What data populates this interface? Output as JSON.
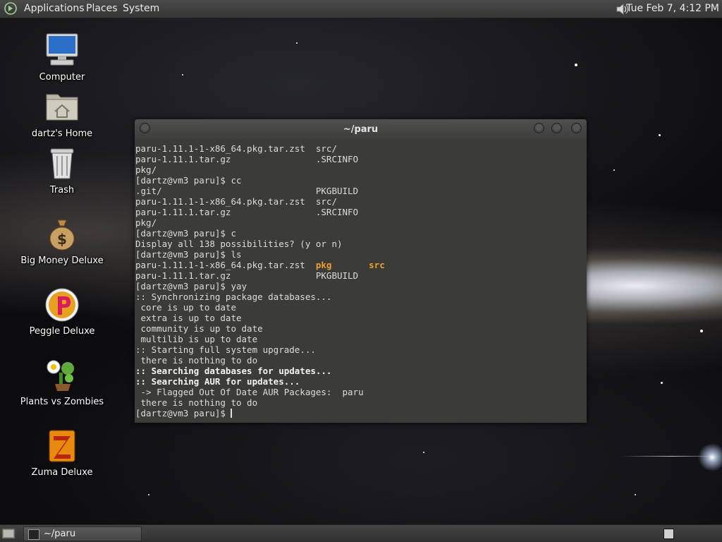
{
  "top_panel": {
    "menus": [
      "Applications",
      "Places",
      "System"
    ],
    "clock": "Tue Feb  7,  4:12 PM",
    "volume_icon": "speaker-icon"
  },
  "desktop": {
    "icons": [
      {
        "label": "Computer",
        "icon": "computer-icon"
      },
      {
        "label": "dartz's Home",
        "icon": "home-folder-icon"
      },
      {
        "label": "Trash",
        "icon": "trash-icon"
      },
      {
        "label": "Big Money Deluxe",
        "icon": "money-bag-icon"
      },
      {
        "label": "Peggle Deluxe",
        "icon": "peggle-icon"
      },
      {
        "label": "Plants vs Zombies",
        "icon": "plant-icon"
      },
      {
        "label": "Zuma Deluxe",
        "icon": "zuma-icon"
      }
    ]
  },
  "terminal": {
    "title": "~/paru",
    "lines": [
      [
        {
          "t": "paru-1.11.1-1-x86_64.pkg.tar.zst  src/"
        }
      ],
      [
        {
          "t": "paru-1.11.1.tar.gz                .SRCINFO"
        }
      ],
      [
        {
          "t": "pkg/"
        }
      ],
      [
        {
          "t": "[dartz@vm3 paru]$ cc"
        }
      ],
      [
        {
          "t": ".git/                             PKGBUILD"
        }
      ],
      [
        {
          "t": "paru-1.11.1-1-x86_64.pkg.tar.zst  src/"
        }
      ],
      [
        {
          "t": "paru-1.11.1.tar.gz                .SRCINFO"
        }
      ],
      [
        {
          "t": "pkg/"
        }
      ],
      [
        {
          "t": "[dartz@vm3 paru]$ c"
        }
      ],
      [
        {
          "t": "Display all 138 possibilities? (y or n)"
        }
      ],
      [
        {
          "t": "[dartz@vm3 paru]$ ls"
        }
      ],
      [
        {
          "t": "paru-1.11.1-1-x86_64.pkg.tar.zst  "
        },
        {
          "t": "pkg",
          "s": "orange"
        },
        {
          "t": "       "
        },
        {
          "t": "src",
          "s": "orange"
        }
      ],
      [
        {
          "t": "paru-1.11.1.tar.gz                PKGBUILD"
        }
      ],
      [
        {
          "t": "[dartz@vm3 paru]$ yay"
        }
      ],
      [
        {
          "t": ":: Synchronizing package databases..."
        }
      ],
      [
        {
          "t": " core is up to date"
        }
      ],
      [
        {
          "t": " extra is up to date"
        }
      ],
      [
        {
          "t": " community is up to date"
        }
      ],
      [
        {
          "t": " multilib is up to date"
        }
      ],
      [
        {
          "t": ":: Starting full system upgrade..."
        }
      ],
      [
        {
          "t": " there is nothing to do"
        }
      ],
      [
        {
          "t": ":: Searching databases for updates...",
          "s": "bold"
        }
      ],
      [
        {
          "t": ":: Searching AUR for updates...",
          "s": "bold"
        }
      ],
      [
        {
          "t": " -> Flagged Out Of Date AUR Packages:  paru"
        }
      ],
      [
        {
          "t": " there is nothing to do"
        }
      ],
      [
        {
          "t": "[dartz@vm3 paru]$ "
        },
        {
          "cursor": true
        }
      ]
    ]
  },
  "taskbar": {
    "task_label": "~/paru"
  }
}
